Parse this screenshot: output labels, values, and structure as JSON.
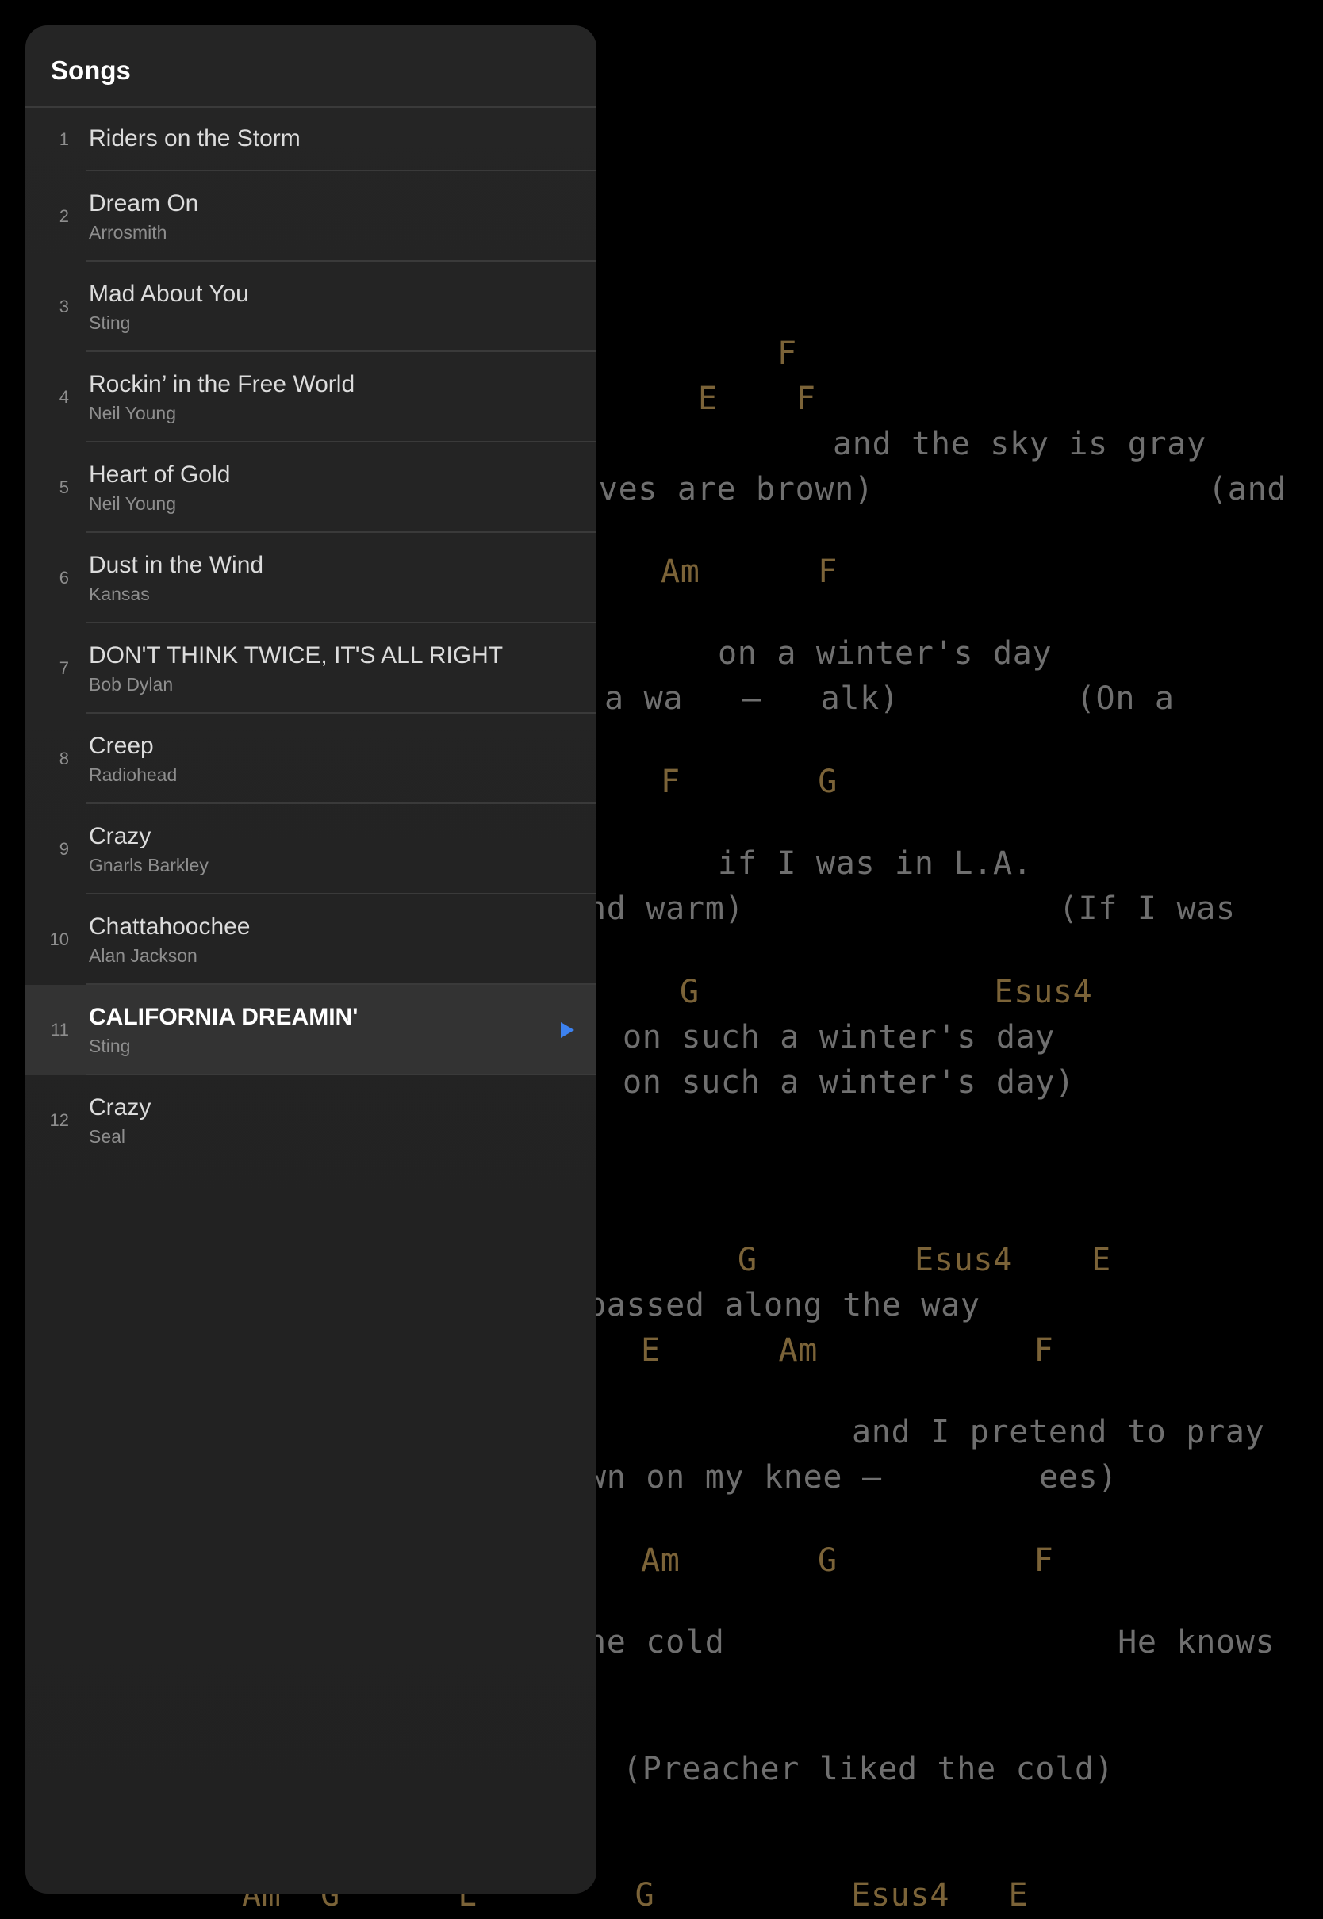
{
  "panel": {
    "title": "Songs",
    "songs": [
      {
        "number": "1",
        "title": "Riders on the Storm",
        "artist": ""
      },
      {
        "number": "2",
        "title": "Dream On",
        "artist": "Arrosmith"
      },
      {
        "number": "3",
        "title": "Mad About You",
        "artist": "Sting"
      },
      {
        "number": "4",
        "title": "Rockin’ in the Free World",
        "artist": "Neil Young"
      },
      {
        "number": "5",
        "title": "Heart of Gold",
        "artist": "Neil Young"
      },
      {
        "number": "6",
        "title": "Dust in the Wind",
        "artist": "Kansas"
      },
      {
        "number": "7",
        "title": "DON'T THINK TWICE, IT'S ALL RIGHT",
        "artist": "Bob Dylan"
      },
      {
        "number": "8",
        "title": "Creep",
        "artist": "Radiohead"
      },
      {
        "number": "9",
        "title": "Crazy",
        "artist": "Gnarls Barkley"
      },
      {
        "number": "10",
        "title": "Chattahoochee",
        "artist": "Alan Jackson"
      },
      {
        "number": "11",
        "title": "CALIFORNIA DREAMIN'",
        "artist": "Sting",
        "selected": true,
        "icon": "play-icon"
      },
      {
        "number": "12",
        "title": "Crazy",
        "artist": "Seal"
      }
    ]
  },
  "sheet": {
    "lines": [
      {
        "kind": "chord",
        "text": "F"
      },
      {
        "kind": "chord",
        "text": "E    F"
      },
      {
        "kind": "lyric",
        "text": "and the sky is gray"
      },
      {
        "kind": "lyric",
        "text": "aves are brown)                 (and"
      },
      {
        "kind": "chord",
        "text": "Am      F"
      },
      {
        "kind": "lyric",
        "text": "on a winter's day"
      },
      {
        "kind": "lyric",
        "text": "a wa   –   alk)         (On a"
      },
      {
        "kind": "chord",
        "text": "F       G"
      },
      {
        "kind": "lyric",
        "text": "if I was in L.A."
      },
      {
        "kind": "lyric",
        "text": "nd warm)                (If I was"
      },
      {
        "kind": "chord",
        "text": "G               Esus4"
      },
      {
        "kind": "lyric",
        "text": "on such a winter's day"
      },
      {
        "kind": "lyric",
        "text": "on such a winter's day)"
      },
      {
        "kind": "chord",
        "text": "G        Esus4    E"
      },
      {
        "kind": "lyric",
        "text": "passed along the way"
      },
      {
        "kind": "chord",
        "text": "E      Am           F"
      },
      {
        "kind": "lyric",
        "text": "and I pretend to pray"
      },
      {
        "kind": "lyric",
        "text": "wn on my knee –        ees)"
      },
      {
        "kind": "chord",
        "text": "Am       G          F"
      },
      {
        "kind": "lyric",
        "text": "he cold                    He knows"
      },
      {
        "kind": "lyric",
        "text": "(Preacher liked the cold)"
      },
      {
        "kind": "chord",
        "text": "Am  G      E        G          Esus4   E"
      }
    ]
  },
  "colors": {
    "background": "#000000",
    "panel": "#232323",
    "selected_row": "#333333",
    "chord": "#7b6338",
    "lyric": "#6f6f6f",
    "accent": "#3d82f0"
  }
}
